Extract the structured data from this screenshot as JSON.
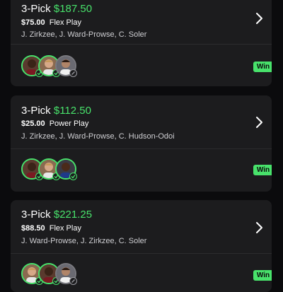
{
  "cards": [
    {
      "pick_label": "3-Pick",
      "payout": "$187.50",
      "stake": "$75.00",
      "play_type": "Flex Play",
      "players": "J. Zirkzee, J. Ward-Prowse, C. Soler",
      "result": "Win",
      "avatar_status": [
        "win",
        "win",
        "pending"
      ]
    },
    {
      "pick_label": "3-Pick",
      "payout": "$112.50",
      "stake": "$25.00",
      "play_type": "Power Play",
      "players": "J. Zirkzee, J. Ward-Prowse, C. Hudson-Odoi",
      "result": "Win",
      "avatar_status": [
        "win",
        "win",
        "win"
      ]
    },
    {
      "pick_label": "3-Pick",
      "payout": "$221.25",
      "stake": "$88.50",
      "play_type": "Flex Play",
      "players": "J. Ward-Prowse, J. Zirkzee, C. Soler",
      "result": "Win",
      "avatar_status": [
        "win",
        "win",
        "pending"
      ]
    }
  ],
  "colors": {
    "accent": "#48e26b",
    "card_bg": "#1c1c1e",
    "page_bg": "#0b0b0d"
  },
  "icons": {
    "chevron": "chevron-right-icon",
    "win_badge": "check-icon",
    "pending_badge": "slash-icon"
  }
}
